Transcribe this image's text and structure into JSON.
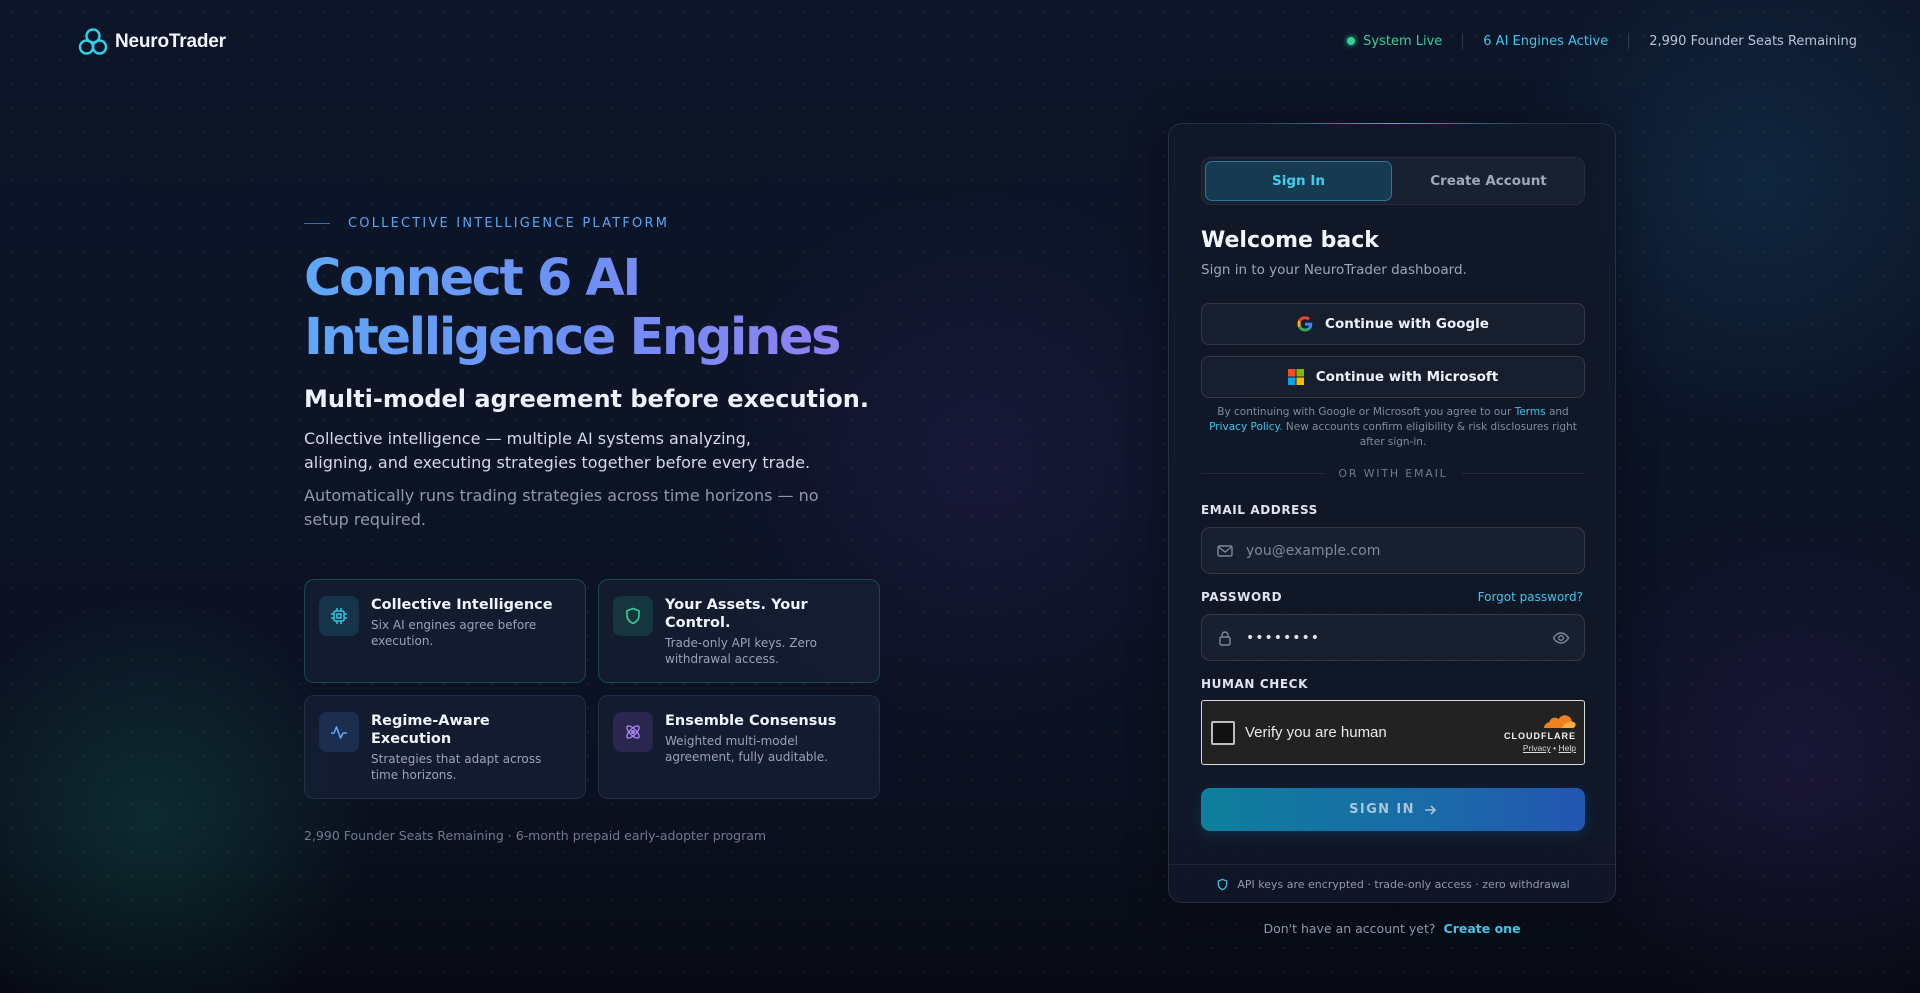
{
  "header": {
    "brand": "NeuroTrader",
    "status_live": "System Live",
    "engines_active": "6 AI Engines Active",
    "seats_remaining": "2,990 Founder Seats Remaining"
  },
  "hero": {
    "eyebrow": "COLLECTIVE INTELLIGENCE PLATFORM",
    "title": "Connect 6 AI Intelligence Engines",
    "subtitle": "Multi-model agreement before execution.",
    "paragraph1": "Collective intelligence — multiple AI systems analyzing, aligning, and executing strategies together before every trade.",
    "paragraph2": "Automatically runs trading strategies across time horizons — no setup required.",
    "features": [
      {
        "title": "Collective Intelligence",
        "desc": "Six AI engines agree before execution.",
        "icon": "chip-icon"
      },
      {
        "title": "Your Assets. Your Control.",
        "desc": "Trade-only API keys. Zero withdrawal access.",
        "icon": "shield-icon"
      },
      {
        "title": "Regime-Aware Execution",
        "desc": "Strategies that adapt across time horizons.",
        "icon": "activity-icon"
      },
      {
        "title": "Ensemble Consensus",
        "desc": "Weighted multi-model agreement, fully auditable.",
        "icon": "atom-icon"
      }
    ],
    "footnote": "2,990 Founder Seats Remaining · 6-month prepaid early-adopter program"
  },
  "auth": {
    "tabs": [
      "Sign In",
      "Create Account"
    ],
    "active_tab": "Sign In",
    "title": "Welcome back",
    "subtitle": "Sign in to your NeuroTrader dashboard.",
    "google_label": "Continue with Google",
    "microsoft_label": "Continue with Microsoft",
    "legal_prefix": "By continuing with Google or Microsoft you agree to our",
    "legal_terms": "Terms",
    "legal_and": "and",
    "legal_privacy": "Privacy Policy",
    "legal_suffix": ". New accounts confirm eligibility & risk disclosures right after sign-in.",
    "divider": "OR WITH EMAIL",
    "email_label": "EMAIL ADDRESS",
    "email_placeholder": "you@example.com",
    "password_label": "PASSWORD",
    "forgot": "Forgot password?",
    "password_value": "••••••••",
    "human_label": "HUMAN CHECK",
    "captcha_text": "Verify you are human",
    "captcha_brand": "CLOUDFLARE",
    "captcha_privacy": "Privacy",
    "captcha_sep": "•",
    "captcha_help": "Help",
    "submit": "SIGN IN",
    "security_note": "API keys are encrypted · trade-only access · zero withdrawal",
    "no_account": "Don't have an account yet?",
    "create_link": "Create one"
  },
  "colors": {
    "accent_cyan": "#3fc6e8",
    "live_green": "#2fd49a",
    "background": "#0b1120"
  }
}
